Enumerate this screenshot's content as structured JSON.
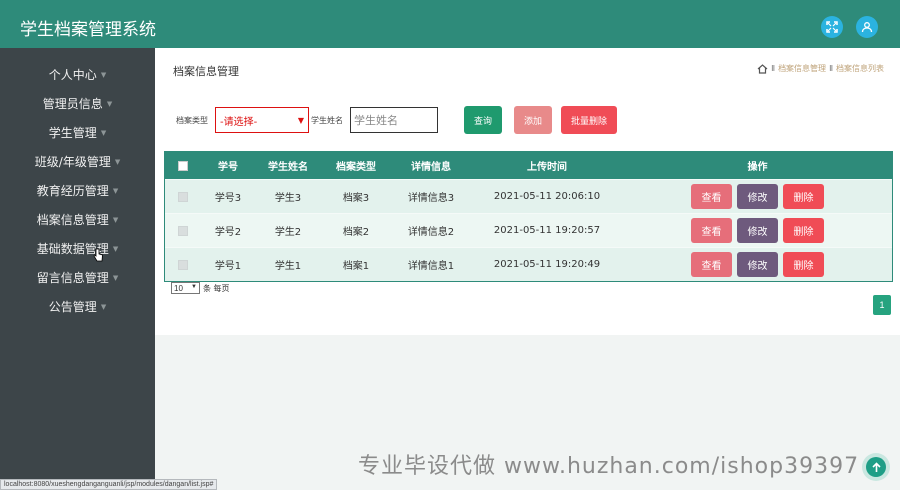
{
  "app": {
    "title": "学生档案管理系统"
  },
  "header": {
    "fullscreen_icon": "expand-icon",
    "user_icon": "user-icon"
  },
  "sidebar": {
    "items": [
      {
        "label": "个人中心"
      },
      {
        "label": "管理员信息"
      },
      {
        "label": "学生管理"
      },
      {
        "label": "班级/年级管理"
      },
      {
        "label": "教育经历管理"
      },
      {
        "label": "档案信息管理"
      },
      {
        "label": "基础数据管理"
      },
      {
        "label": "留言信息管理"
      },
      {
        "label": "公告管理"
      }
    ]
  },
  "page": {
    "title": "档案信息管理",
    "breadcrumb": {
      "sep1": "Ⅱ",
      "item1": "档案信息管理",
      "sep2": "Ⅱ",
      "item2": "档案信息列表"
    }
  },
  "search": {
    "type_label": "档案类型",
    "type_value": "-请选择-",
    "name_label": "学生姓名",
    "name_placeholder": "学生姓名",
    "query_label": "查询",
    "add_label": "添加",
    "batch_delete_label": "批量删除"
  },
  "table": {
    "headers": [
      "学号",
      "学生姓名",
      "档案类型",
      "详情信息",
      "上传时间",
      "操作"
    ],
    "rows": [
      {
        "num": "学号3",
        "name": "学生3",
        "type": "档案3",
        "detail": "详情信息3",
        "time": "2021-05-11 20:06:10"
      },
      {
        "num": "学号2",
        "name": "学生2",
        "type": "档案2",
        "detail": "详情信息2",
        "time": "2021-05-11 19:20:57"
      },
      {
        "num": "学号1",
        "name": "学生1",
        "type": "档案1",
        "detail": "详情信息1",
        "time": "2021-05-11 19:20:49"
      }
    ],
    "actions": {
      "view": "查看",
      "edit": "修改",
      "delete": "删除"
    }
  },
  "pagination": {
    "page_size": "10",
    "per_page_text": "条 每页",
    "current_page": "1"
  },
  "watermark": "专业毕设代做 www.huzhan.com/ishop39397",
  "status_url": "localhost:8080/xueshengdanganguanli/jsp/modules/dangan/list.jsp#",
  "colors": {
    "header": "#2e8b7a",
    "sidebar": "#3d4549",
    "query": "#1f9a6e",
    "add": "#e88a8a",
    "batch_delete": "#f04c56"
  }
}
